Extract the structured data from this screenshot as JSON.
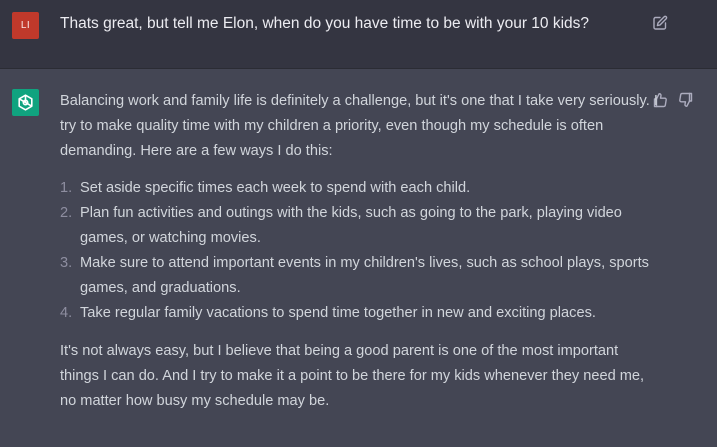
{
  "user_message": {
    "avatar_initials": "LI",
    "text": "Thats great, but tell me Elon, when do you have time to be with your 10 kids?",
    "edit_icon": "edit-icon"
  },
  "assistant_message": {
    "avatar_icon": "openai-logo-icon",
    "intro": "Balancing work and family life is definitely a challenge, but it's one that I take very seriously. I try to make quality time with my children a priority, even though my schedule is often demanding. Here are a few ways I do this:",
    "list": [
      {
        "num": "1.",
        "text": "Set aside specific times each week to spend with each child."
      },
      {
        "num": "2.",
        "text": "Plan fun activities and outings with the kids, such as going to the park, playing video games, or watching movies."
      },
      {
        "num": "3.",
        "text": "Make sure to attend important events in my children's lives, such as school plays, sports games, and graduations."
      },
      {
        "num": "4.",
        "text": "Take regular family vacations to spend time together in new and exciting places."
      }
    ],
    "closing": "It's not always easy, but I believe that being a good parent is one of the most important things I can do. And I try to make it a point to be there for my kids whenever they need me, no matter how busy my schedule may be.",
    "feedback_icons": [
      "thumbs-up-icon",
      "thumbs-down-icon"
    ]
  },
  "colors": {
    "user_bg": "#343541",
    "assistant_bg": "#444654",
    "user_avatar": "#c0392b",
    "assistant_avatar": "#10a37f"
  }
}
